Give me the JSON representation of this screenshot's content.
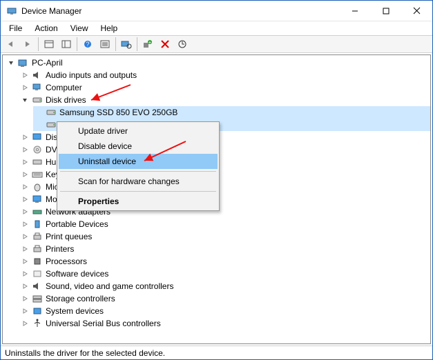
{
  "window": {
    "title": "Device Manager"
  },
  "menu": [
    "File",
    "Action",
    "View",
    "Help"
  ],
  "toolbar_icons": [
    "back",
    "forward",
    "show-hide",
    "properties-bar",
    "help",
    "help2",
    "scan",
    "add-legacy",
    "remove",
    "update"
  ],
  "tree": {
    "root": "PC-April",
    "root_expanded": true,
    "items": [
      {
        "label": "Audio inputs and outputs",
        "exp": "closed",
        "icon": "audio"
      },
      {
        "label": "Computer",
        "exp": "closed",
        "icon": "computer"
      },
      {
        "label": "Disk drives",
        "exp": "open",
        "icon": "disk",
        "children": [
          {
            "label": "Samsung SSD 850 EVO 250GB",
            "exp": "none",
            "icon": "disk"
          }
        ]
      },
      {
        "label": "Disp",
        "exp": "closed",
        "icon": "display"
      },
      {
        "label": "DVD",
        "exp": "closed",
        "icon": "dvd"
      },
      {
        "label": "Hur",
        "exp": "closed",
        "icon": "hid"
      },
      {
        "label": "Keyb",
        "exp": "closed",
        "icon": "keyboard"
      },
      {
        "label": "Mice",
        "exp": "closed",
        "icon": "mouse"
      },
      {
        "label": "Mor",
        "exp": "closed",
        "icon": "monitor"
      },
      {
        "label": "Network adapters",
        "exp": "closed",
        "icon": "network"
      },
      {
        "label": "Portable Devices",
        "exp": "closed",
        "icon": "portable"
      },
      {
        "label": "Print queues",
        "exp": "closed",
        "icon": "printer"
      },
      {
        "label": "Printers",
        "exp": "closed",
        "icon": "printer"
      },
      {
        "label": "Processors",
        "exp": "closed",
        "icon": "cpu"
      },
      {
        "label": "Software devices",
        "exp": "closed",
        "icon": "software"
      },
      {
        "label": "Sound, video and game controllers",
        "exp": "closed",
        "icon": "audio"
      },
      {
        "label": "Storage controllers",
        "exp": "closed",
        "icon": "storage"
      },
      {
        "label": "System devices",
        "exp": "closed",
        "icon": "system"
      },
      {
        "label": "Universal Serial Bus controllers",
        "exp": "closed",
        "icon": "usb"
      }
    ]
  },
  "context_menu": {
    "items": [
      {
        "label": "Update driver",
        "kind": "item"
      },
      {
        "label": "Disable device",
        "kind": "item"
      },
      {
        "label": "Uninstall device",
        "kind": "item",
        "selected": true
      },
      {
        "kind": "sep"
      },
      {
        "label": "Scan for hardware changes",
        "kind": "item"
      },
      {
        "kind": "sep"
      },
      {
        "label": "Properties",
        "kind": "item",
        "bold": true
      }
    ]
  },
  "statusbar": "Uninstalls the driver for the selected device.",
  "annotation_color": "#e11"
}
